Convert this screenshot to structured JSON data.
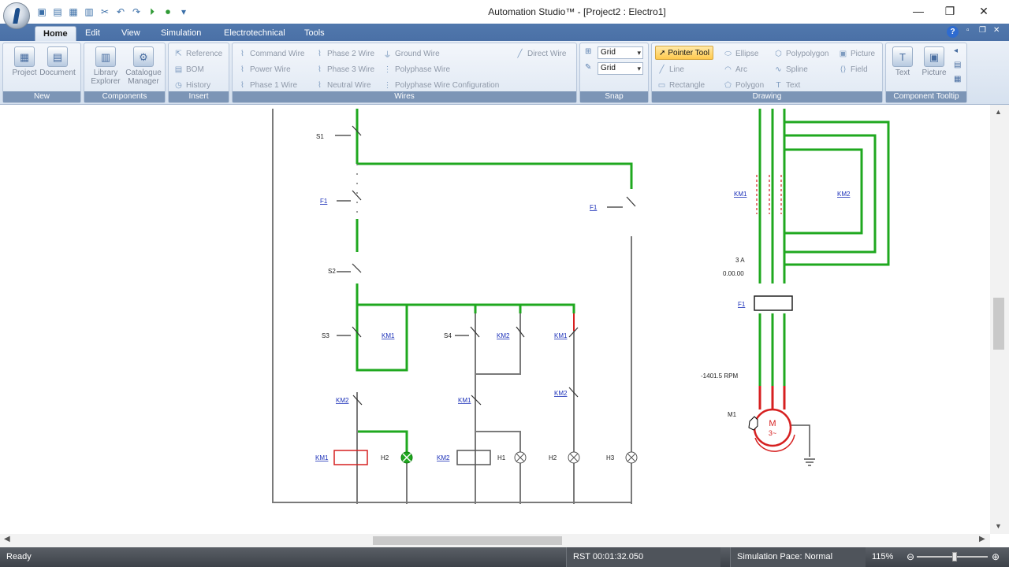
{
  "window": {
    "title": "Automation Studio™ - [Project2 : Electro1]",
    "minimize": "—",
    "maximize": "❐",
    "close": "✕"
  },
  "tabs": [
    {
      "label": "Home"
    },
    {
      "label": "Edit"
    },
    {
      "label": "View"
    },
    {
      "label": "Simulation"
    },
    {
      "label": "Electrotechnical"
    },
    {
      "label": "Tools"
    }
  ],
  "ribbon": {
    "new": {
      "label": "New",
      "project": "Project",
      "document": "Document"
    },
    "components": {
      "label": "Components",
      "library": "Library\nExplorer",
      "catalogue": "Catalogue\nManager"
    },
    "insert": {
      "label": "Insert",
      "reference": "Reference",
      "bom": "BOM",
      "history": "History"
    },
    "wires": {
      "label": "Wires",
      "command_wire": "Command Wire",
      "power_wire": "Power Wire",
      "phase1_wire": "Phase 1 Wire",
      "phase2_wire": "Phase 2 Wire",
      "phase3_wire": "Phase 3 Wire",
      "neutral_wire": "Neutral Wire",
      "ground_wire": "Ground Wire",
      "polyphase_wire": "Polyphase Wire",
      "polyphase_config": "Polyphase Wire Configuration",
      "direct_wire": "Direct Wire"
    },
    "snap": {
      "label": "Snap",
      "grid1": "Grid",
      "grid2": "Grid"
    },
    "drawing": {
      "label": "Drawing",
      "pointer": "Pointer Tool",
      "line": "Line",
      "rectangle": "Rectangle",
      "ellipse": "Ellipse",
      "arc": "Arc",
      "polygon": "Polygon",
      "polypolygon": "Polypolygon",
      "spline": "Spline",
      "text": "Text",
      "picture": "Picture",
      "field": "Field"
    },
    "tooltip": {
      "label": "Component Tooltip",
      "text": "Text",
      "picture": "Picture"
    }
  },
  "diagram": {
    "labels": {
      "s1": "S1",
      "f1_left": "F1",
      "f1_mid": "F1",
      "s2": "S2",
      "s3": "S3",
      "s4": "S4",
      "km1_a": "KM1",
      "km2_a": "KM2",
      "km1_b": "KM1",
      "km2_b": "KM2",
      "km1_c": "KM1",
      "km2_c": "KM2",
      "km1_coil": "KM1",
      "km2_coil": "KM2",
      "h2_a": "H2",
      "h1": "H1",
      "h2_b": "H2",
      "h3": "H3",
      "km1_power": "KM1",
      "km2_power": "KM2",
      "f1_power": "F1",
      "m1": "M1"
    },
    "readouts": {
      "current": "3 A",
      "time": "0.00.00",
      "rpm": "-1401.5 RPM"
    },
    "motor_text": "M\n3~",
    "colors": {
      "energized": "#1fa81f",
      "deenergized": "#7a7a7a",
      "active": "#d62020",
      "link": "#1a2fb8"
    }
  },
  "status": {
    "ready": "Ready",
    "timer": "RST 00:01:32.050",
    "pace": "Simulation Pace: Normal",
    "zoom": "115%"
  }
}
